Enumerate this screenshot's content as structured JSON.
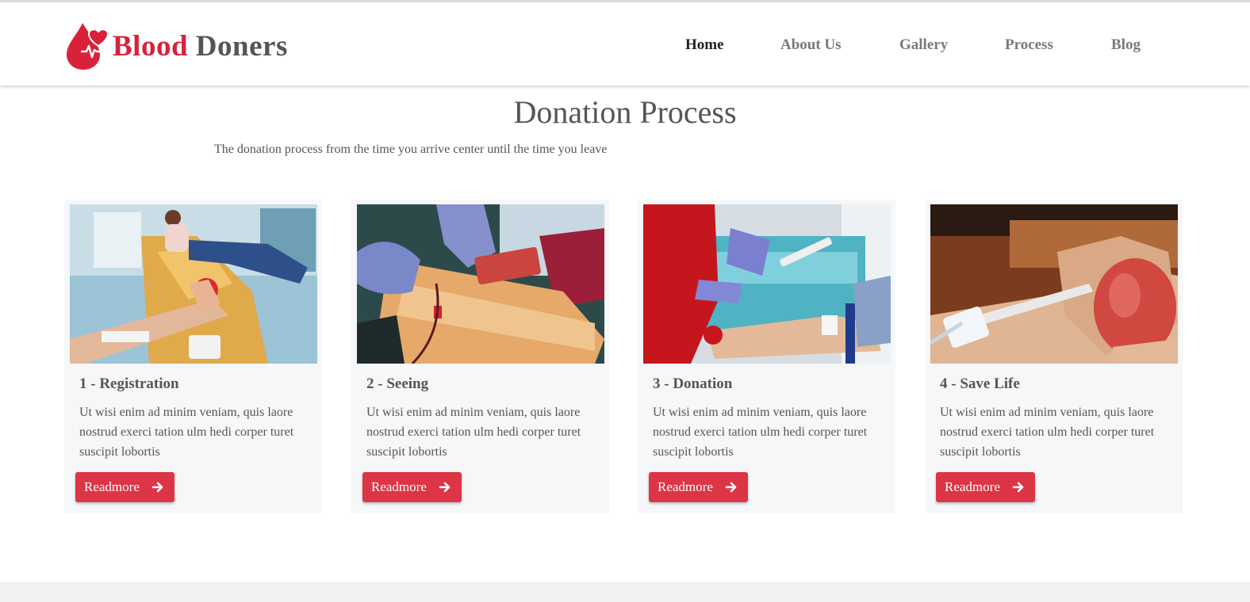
{
  "brand": {
    "name_part1": "Blood",
    "name_part2": "Doners",
    "logo_icon": "blood-drop-heart-icon",
    "accent": "#d9213a"
  },
  "nav": {
    "items": [
      {
        "label": "Home",
        "active": true
      },
      {
        "label": "About Us",
        "active": false
      },
      {
        "label": "Gallery",
        "active": false
      },
      {
        "label": "Process",
        "active": false
      },
      {
        "label": "Blog",
        "active": false
      }
    ]
  },
  "section": {
    "title": "Donation Process",
    "subtitle": "The donation process from the time you arrive center until the time you leave"
  },
  "cards": [
    {
      "title": "1 - Registration",
      "text": "Ut wisi enim ad minim veniam, quis laore nostrud exerci tation ulm hedi corper turet suscipit lobortis",
      "button": "Readmore",
      "image": "photo-donor-in-chair-squeezing-ball"
    },
    {
      "title": "2 - Seeing",
      "text": "Ut wisi enim ad minim veniam, quis laore nostrud exerci tation ulm hedi corper turet suscipit lobortis",
      "button": "Readmore",
      "image": "photo-gloved-hands-blood-bag"
    },
    {
      "title": "3 - Donation",
      "text": "Ut wisi enim ad minim veniam, quis laore nostrud exerci tation ulm hedi corper turet suscipit lobortis",
      "button": "Readmore",
      "image": "photo-nurse-inserting-needle"
    },
    {
      "title": "4 - Save Life",
      "text": "Ut wisi enim ad minim veniam, quis laore nostrud exerci tation ulm hedi corper turet suscipit lobortis",
      "button": "Readmore",
      "image": "photo-hand-squeezing-red-ball"
    }
  ],
  "colors": {
    "button": "#dc3545",
    "card_background": "#f6f7f9",
    "text": "#555555"
  }
}
